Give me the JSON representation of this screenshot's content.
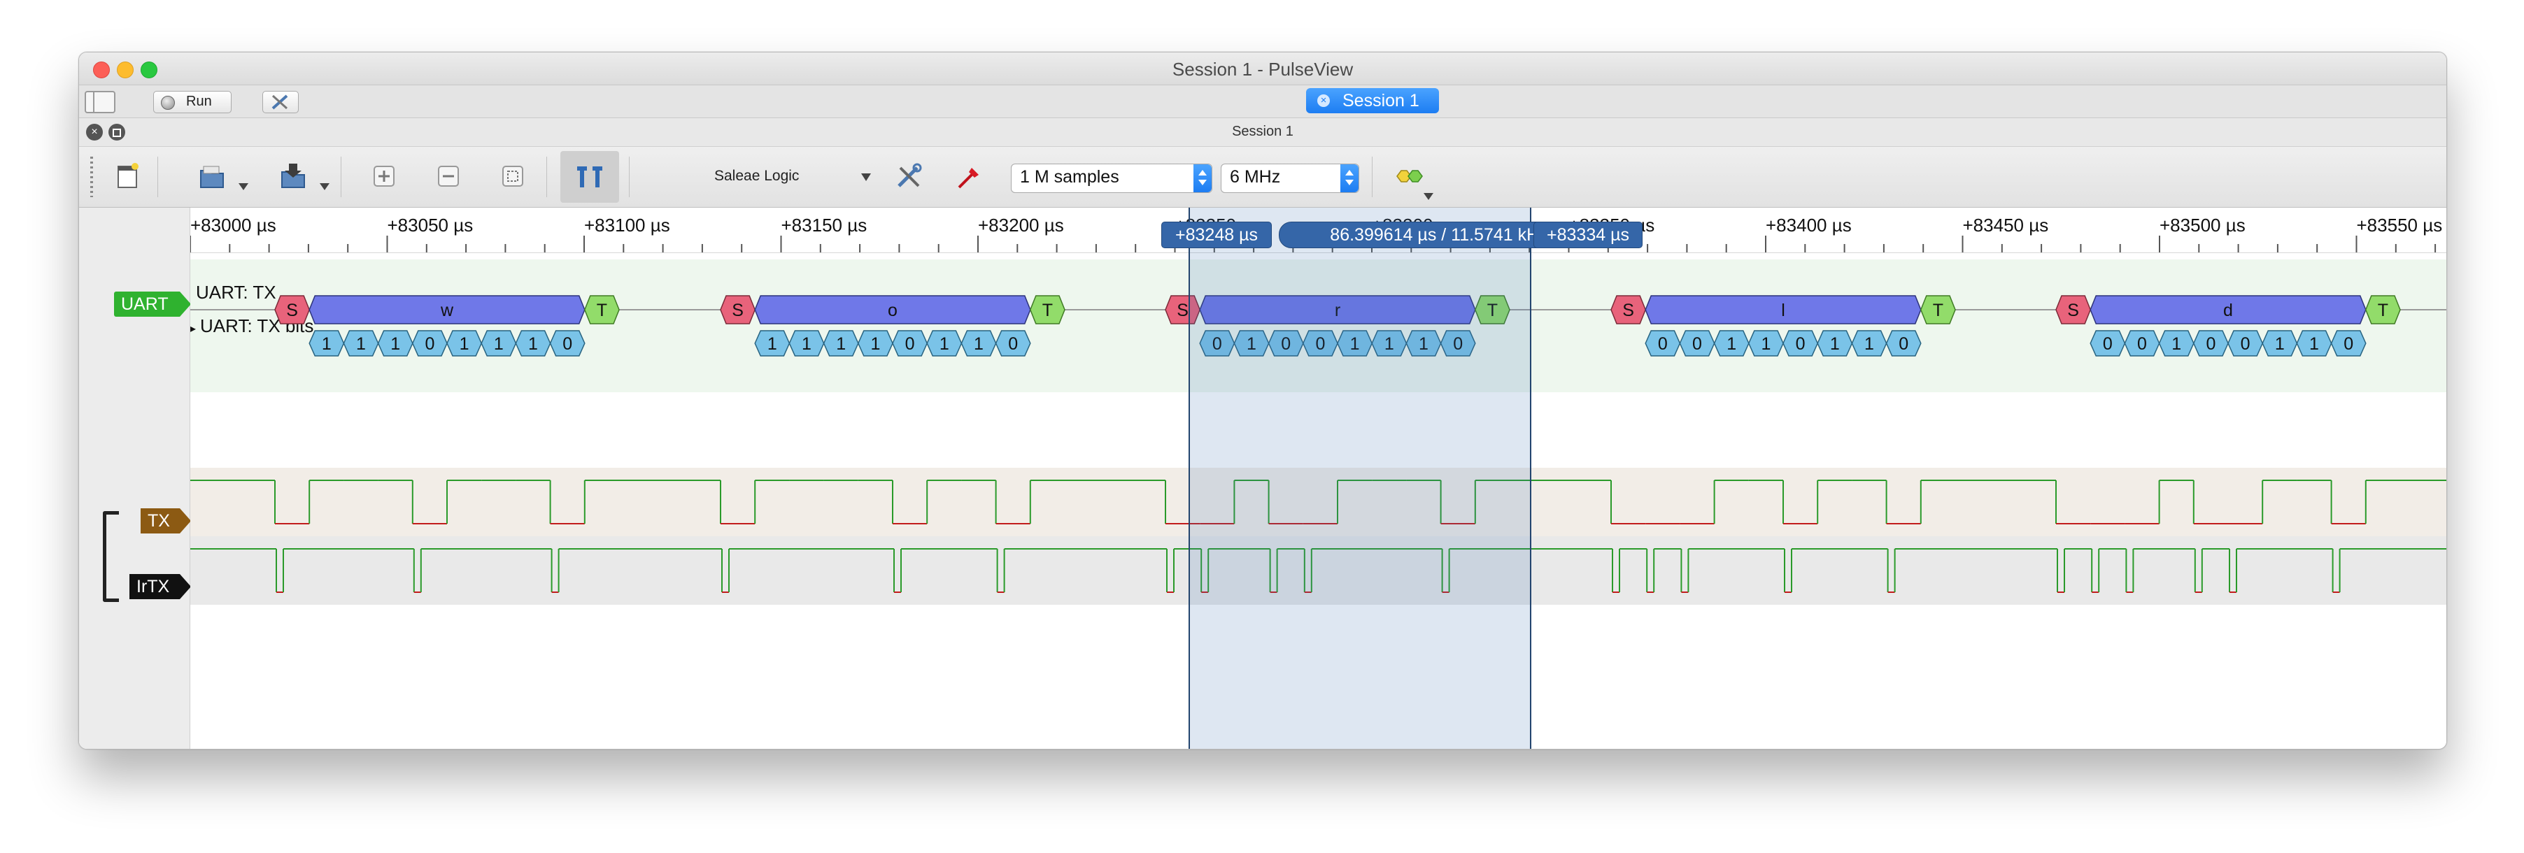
{
  "window": {
    "title": "Session 1 - PulseView"
  },
  "tabbar": {
    "run_label": "Run",
    "session_tab": "Session 1",
    "session_tab_close": "×"
  },
  "session": {
    "title": "Session 1",
    "close_glyph": "×"
  },
  "toolbar": {
    "device": "Saleae Logic",
    "samples": "1 M samples",
    "samplerate": "6 MHz"
  },
  "channels": {
    "uart": "UART",
    "tx": "TX",
    "irtx": "IrTX"
  },
  "decoder": {
    "row1_label": "UART: TX",
    "row2_label": "UART: TX bits"
  },
  "ruler": {
    "labels": [
      "+83000 µs",
      "+83050 µs",
      "+83100 µs",
      "+83150 µs",
      "+83200 µs",
      "+83250 µs",
      "+83300 µs",
      "+83350 µs",
      "+83400 µs",
      "+83450 µs",
      "+83500 µs",
      "+83550 µs"
    ]
  },
  "measure": {
    "left": "+83248 µs",
    "center": "86.399614 µs / 11.5741 kHz",
    "right": "+83334 µs"
  },
  "frames": [
    {
      "start": "S",
      "char": "w",
      "stop": "T",
      "bits": [
        "1",
        "1",
        "1",
        "0",
        "1",
        "1",
        "1",
        "0"
      ]
    },
    {
      "start": "S",
      "char": "o",
      "stop": "T",
      "bits": [
        "1",
        "1",
        "1",
        "1",
        "0",
        "1",
        "1",
        "0"
      ]
    },
    {
      "start": "S",
      "char": "r",
      "stop": "T",
      "bits": [
        "0",
        "1",
        "0",
        "0",
        "1",
        "1",
        "1",
        "0"
      ]
    },
    {
      "start": "S",
      "char": "l",
      "stop": "T",
      "bits": [
        "0",
        "0",
        "1",
        "1",
        "0",
        "1",
        "1",
        "0"
      ]
    },
    {
      "start": "S",
      "char": "d",
      "stop": "T",
      "bits": [
        "0",
        "0",
        "1",
        "0",
        "0",
        "1",
        "1",
        "0"
      ]
    }
  ],
  "colors": {
    "start_bit": "#e8637b",
    "data_char": "#6f78e8",
    "stop_bit": "#92dc6a",
    "bit_value": "#7ac3e8",
    "uart_badge": "#2fb22f",
    "tx_badge": "#8c5a13",
    "irtx_badge": "#111111",
    "selection": "#3566a8"
  }
}
